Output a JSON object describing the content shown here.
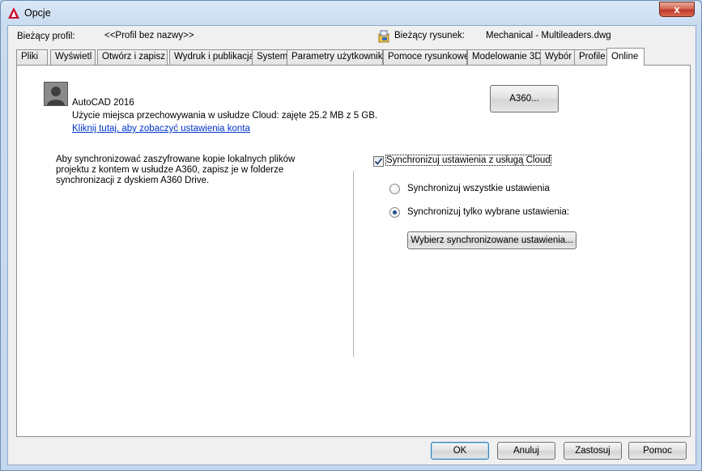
{
  "window": {
    "title": "Opcje",
    "close_glyph": "x"
  },
  "profile": {
    "label": "Bieżący profil:",
    "value": "<<Profil bez nazwy>>",
    "drawing_label": "Bieżący rysunek:",
    "drawing_value": "Mechanical - Multileaders.dwg"
  },
  "tabs": [
    {
      "label": "Pliki"
    },
    {
      "label": "Wyświetl"
    },
    {
      "label": "Otwórz i zapisz"
    },
    {
      "label": "Wydruk i publikacja"
    },
    {
      "label": "System"
    },
    {
      "label": "Parametry użytkownika"
    },
    {
      "label": "Pomoce rysunkowe"
    },
    {
      "label": "Modelowanie 3D"
    },
    {
      "label": "Wybór"
    },
    {
      "label": "Profile"
    },
    {
      "label": "Online"
    }
  ],
  "active_tab": "Online",
  "online": {
    "product": "AutoCAD 2016",
    "storage": "Użycie miejsca przechowywania w usłudze Cloud: zajęte 25.2 MB z 5 GB.",
    "account_link": "Kliknij tutaj, aby zobaczyć ustawienia konta",
    "a360_button": "A360...",
    "info": "Aby synchronizować zaszyfrowane kopie lokalnych plików projektu z kontem w usłudze A360, zapisz je w folderze synchronizacji z dyskiem A360 Drive.",
    "sync_checkbox": {
      "label": "Synchronizuj ustawienia z usługą Cloud",
      "checked": true
    },
    "radio_all": {
      "label": "Synchronizuj wszystkie ustawienia",
      "selected": false
    },
    "radio_selected": {
      "label": "Synchronizuj tylko wybrane ustawienia:",
      "selected": true
    },
    "choose_button": "Wybierz synchronizowane ustawienia..."
  },
  "footer": {
    "ok": "OK",
    "cancel": "Anuluj",
    "apply": "Zastosuj",
    "help": "Pomoc"
  },
  "colors": {
    "link": "#0033cc",
    "accent": "#3c7fb1",
    "app_icon": "#c8102e"
  }
}
